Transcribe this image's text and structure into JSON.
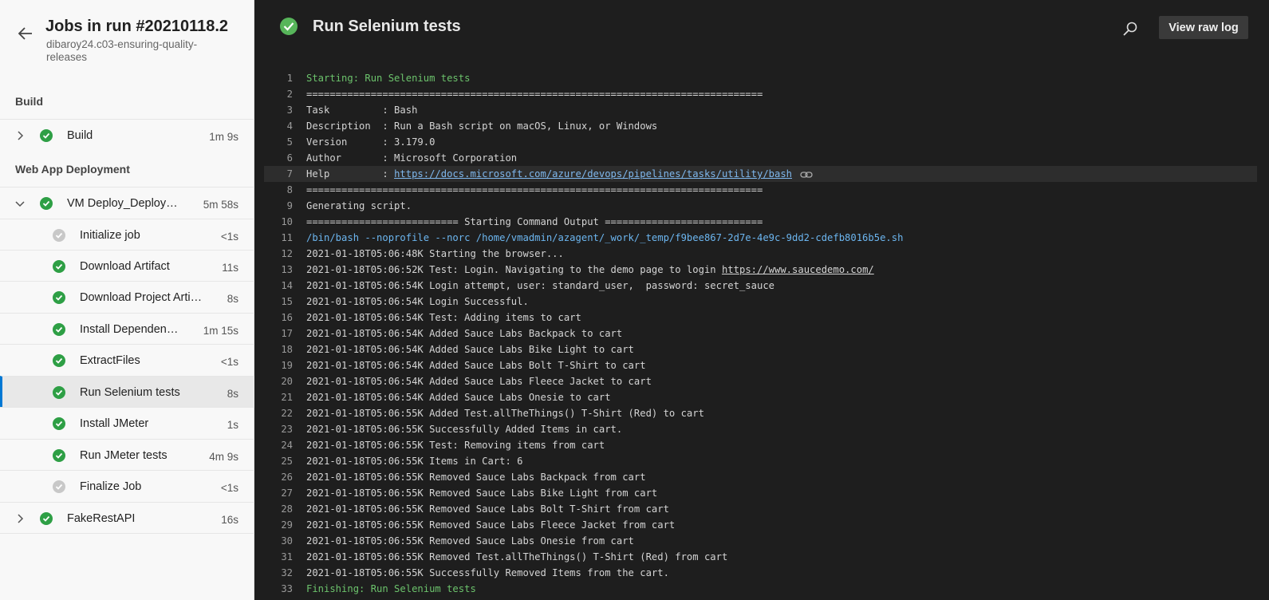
{
  "sidebar": {
    "title": "Jobs in run #20210118.2",
    "subtitle": "dibaroy24.c03-ensuring-quality-releases",
    "sections": [
      {
        "label": "Build"
      },
      {
        "label": "Web App Deployment"
      }
    ],
    "jobs": [
      {
        "name": "Build",
        "duration": "1m 9s"
      },
      {
        "name": "VM Deploy_Deploy…",
        "duration": "5m 58s"
      },
      {
        "name": "Initialize job",
        "duration": "<1s"
      },
      {
        "name": "Download Artifact",
        "duration": "11s"
      },
      {
        "name": "Download Project Arti…",
        "duration": "8s"
      },
      {
        "name": "Install Dependen…",
        "duration": "1m 15s"
      },
      {
        "name": "ExtractFiles",
        "duration": "<1s"
      },
      {
        "name": "Run Selenium tests",
        "duration": "8s"
      },
      {
        "name": "Install JMeter",
        "duration": "1s"
      },
      {
        "name": "Run JMeter tests",
        "duration": "4m 9s"
      },
      {
        "name": "Finalize Job",
        "duration": "<1s"
      },
      {
        "name": "FakeRestAPI",
        "duration": "16s"
      }
    ]
  },
  "main": {
    "title": "Run Selenium tests",
    "raw_log_label": "View raw log"
  },
  "log": {
    "lines": [
      {
        "n": "1",
        "text": "Starting: Run Selenium tests"
      },
      {
        "n": "2",
        "text": "=============================================================================="
      },
      {
        "n": "3",
        "text": "Task         : Bash"
      },
      {
        "n": "4",
        "text": "Description  : Run a Bash script on macOS, Linux, or Windows"
      },
      {
        "n": "5",
        "text": "Version      : 3.179.0"
      },
      {
        "n": "6",
        "text": "Author       : Microsoft Corporation"
      },
      {
        "n": "7",
        "text": "Help         : ",
        "link": "https://docs.microsoft.com/azure/devops/pipelines/tasks/utility/bash"
      },
      {
        "n": "8",
        "text": "=============================================================================="
      },
      {
        "n": "9",
        "text": "Generating script."
      },
      {
        "n": "10",
        "text": "========================== Starting Command Output ==========================="
      },
      {
        "n": "11",
        "text": "/bin/bash --noprofile --norc /home/vmadmin/azagent/_work/_temp/f9bee867-2d7e-4e9c-9dd2-cdefb8016b5e.sh"
      },
      {
        "n": "12",
        "text": "2021-01-18T05:06:48K Starting the browser..."
      },
      {
        "n": "13",
        "text": "2021-01-18T05:06:52K Test: Login. Navigating to the demo page to login ",
        "link": "https://www.saucedemo.com/"
      },
      {
        "n": "14",
        "text": "2021-01-18T05:06:54K Login attempt, user: standard_user,  password: secret_sauce"
      },
      {
        "n": "15",
        "text": "2021-01-18T05:06:54K Login Successful."
      },
      {
        "n": "16",
        "text": "2021-01-18T05:06:54K Test: Adding items to cart"
      },
      {
        "n": "17",
        "text": "2021-01-18T05:06:54K Added Sauce Labs Backpack to cart"
      },
      {
        "n": "18",
        "text": "2021-01-18T05:06:54K Added Sauce Labs Bike Light to cart"
      },
      {
        "n": "19",
        "text": "2021-01-18T05:06:54K Added Sauce Labs Bolt T-Shirt to cart"
      },
      {
        "n": "20",
        "text": "2021-01-18T05:06:54K Added Sauce Labs Fleece Jacket to cart"
      },
      {
        "n": "21",
        "text": "2021-01-18T05:06:54K Added Sauce Labs Onesie to cart"
      },
      {
        "n": "22",
        "text": "2021-01-18T05:06:55K Added Test.allTheThings() T-Shirt (Red) to cart"
      },
      {
        "n": "23",
        "text": "2021-01-18T05:06:55K Successfully Added Items in cart."
      },
      {
        "n": "24",
        "text": "2021-01-18T05:06:55K Test: Removing items from cart"
      },
      {
        "n": "25",
        "text": "2021-01-18T05:06:55K Items in Cart: 6"
      },
      {
        "n": "26",
        "text": "2021-01-18T05:06:55K Removed Sauce Labs Backpack from cart"
      },
      {
        "n": "27",
        "text": "2021-01-18T05:06:55K Removed Sauce Labs Bike Light from cart"
      },
      {
        "n": "28",
        "text": "2021-01-18T05:06:55K Removed Sauce Labs Bolt T-Shirt from cart"
      },
      {
        "n": "29",
        "text": "2021-01-18T05:06:55K Removed Sauce Labs Fleece Jacket from cart"
      },
      {
        "n": "30",
        "text": "2021-01-18T05:06:55K Removed Sauce Labs Onesie from cart"
      },
      {
        "n": "31",
        "text": "2021-01-18T05:06:55K Removed Test.allTheThings() T-Shirt (Red) from cart"
      },
      {
        "n": "32",
        "text": "2021-01-18T05:06:55K Successfully Removed Items from the cart."
      },
      {
        "n": "33",
        "text": "Finishing: Run Selenium tests"
      }
    ]
  },
  "icons": {
    "back": "arrow-left-icon",
    "search": "search-icon",
    "expand": "chevron-right-icon",
    "collapse": "chevron-down-icon",
    "success": "check-circle-icon",
    "skipped": "check-circle-gray-icon",
    "copy_link": "link-icon"
  },
  "colors": {
    "success": "#2e9f45",
    "skipped": "#c8c8c8",
    "log_green": "#6cc36c",
    "log_blue": "#6cb6f0",
    "selected_accent": "#0078d4"
  }
}
